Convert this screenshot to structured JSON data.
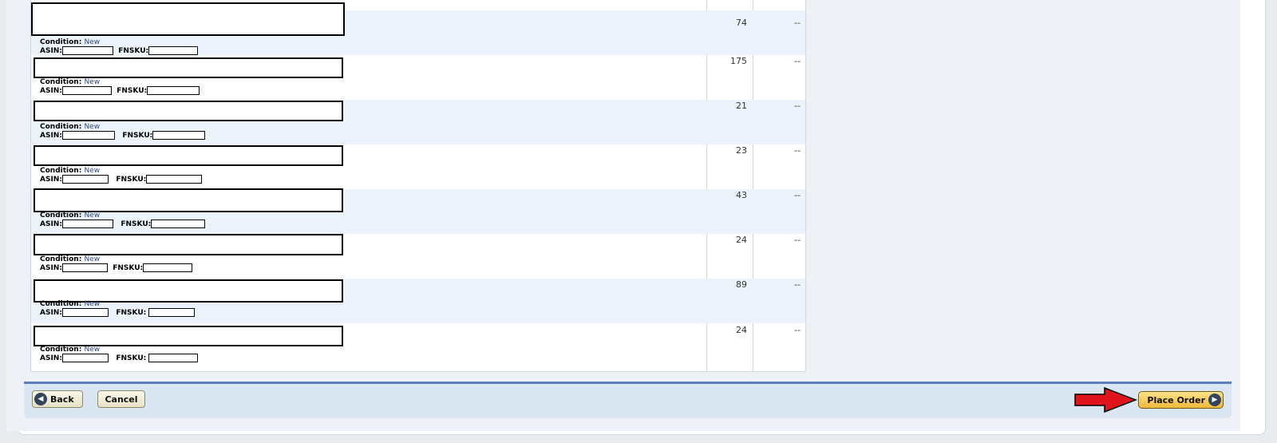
{
  "items": [
    {
      "condition_label": "Condition:",
      "condition": "New",
      "asin_label": "ASIN:",
      "fnsku_label": "FNSKU:",
      "quantity": "74",
      "extra": "--"
    },
    {
      "condition_label": "Condition:",
      "condition": "New",
      "asin_label": "ASIN:",
      "fnsku_label": "FNSKU:",
      "quantity": "175",
      "extra": "--"
    },
    {
      "condition_label": "Condition:",
      "condition": "New",
      "asin_label": "ASIN:",
      "fnsku_label": "FNSKU:",
      "quantity": "21",
      "extra": "--"
    },
    {
      "condition_label": "Condition:",
      "condition": "New",
      "asin_label": "ASIN:",
      "fnsku_label": "FNSKU:",
      "quantity": "23",
      "extra": "--"
    },
    {
      "condition_label": "Condition:",
      "condition": "New",
      "asin_label": "ASIN:",
      "fnsku_label": "FNSKU:",
      "quantity": "43",
      "extra": "--"
    },
    {
      "condition_label": "Condition:",
      "condition": "New",
      "asin_label": "ASIN:",
      "fnsku_label": "FNSKU:",
      "quantity": "24",
      "extra": "--"
    },
    {
      "condition_label": "Condition:",
      "condition": "New",
      "asin_label": "ASIN:",
      "fnsku_label": "FNSKU:",
      "quantity": "89",
      "extra": "--"
    },
    {
      "condition_label": "Condition:",
      "condition": "New",
      "asin_label": "ASIN:",
      "fnsku_label": "FNSKU:",
      "quantity": "24",
      "extra": "--"
    }
  ],
  "footer": {
    "back_label": "Back",
    "cancel_label": "Cancel",
    "place_order_label": "Place Order"
  },
  "icons": {
    "back": "chevron-left-icon",
    "next": "chevron-right-icon",
    "pointer": "red-arrow-icon"
  },
  "colors": {
    "accent_bar": "#5b7fb9",
    "place_order": "#f0b93a",
    "arrow": "#e0141c"
  }
}
